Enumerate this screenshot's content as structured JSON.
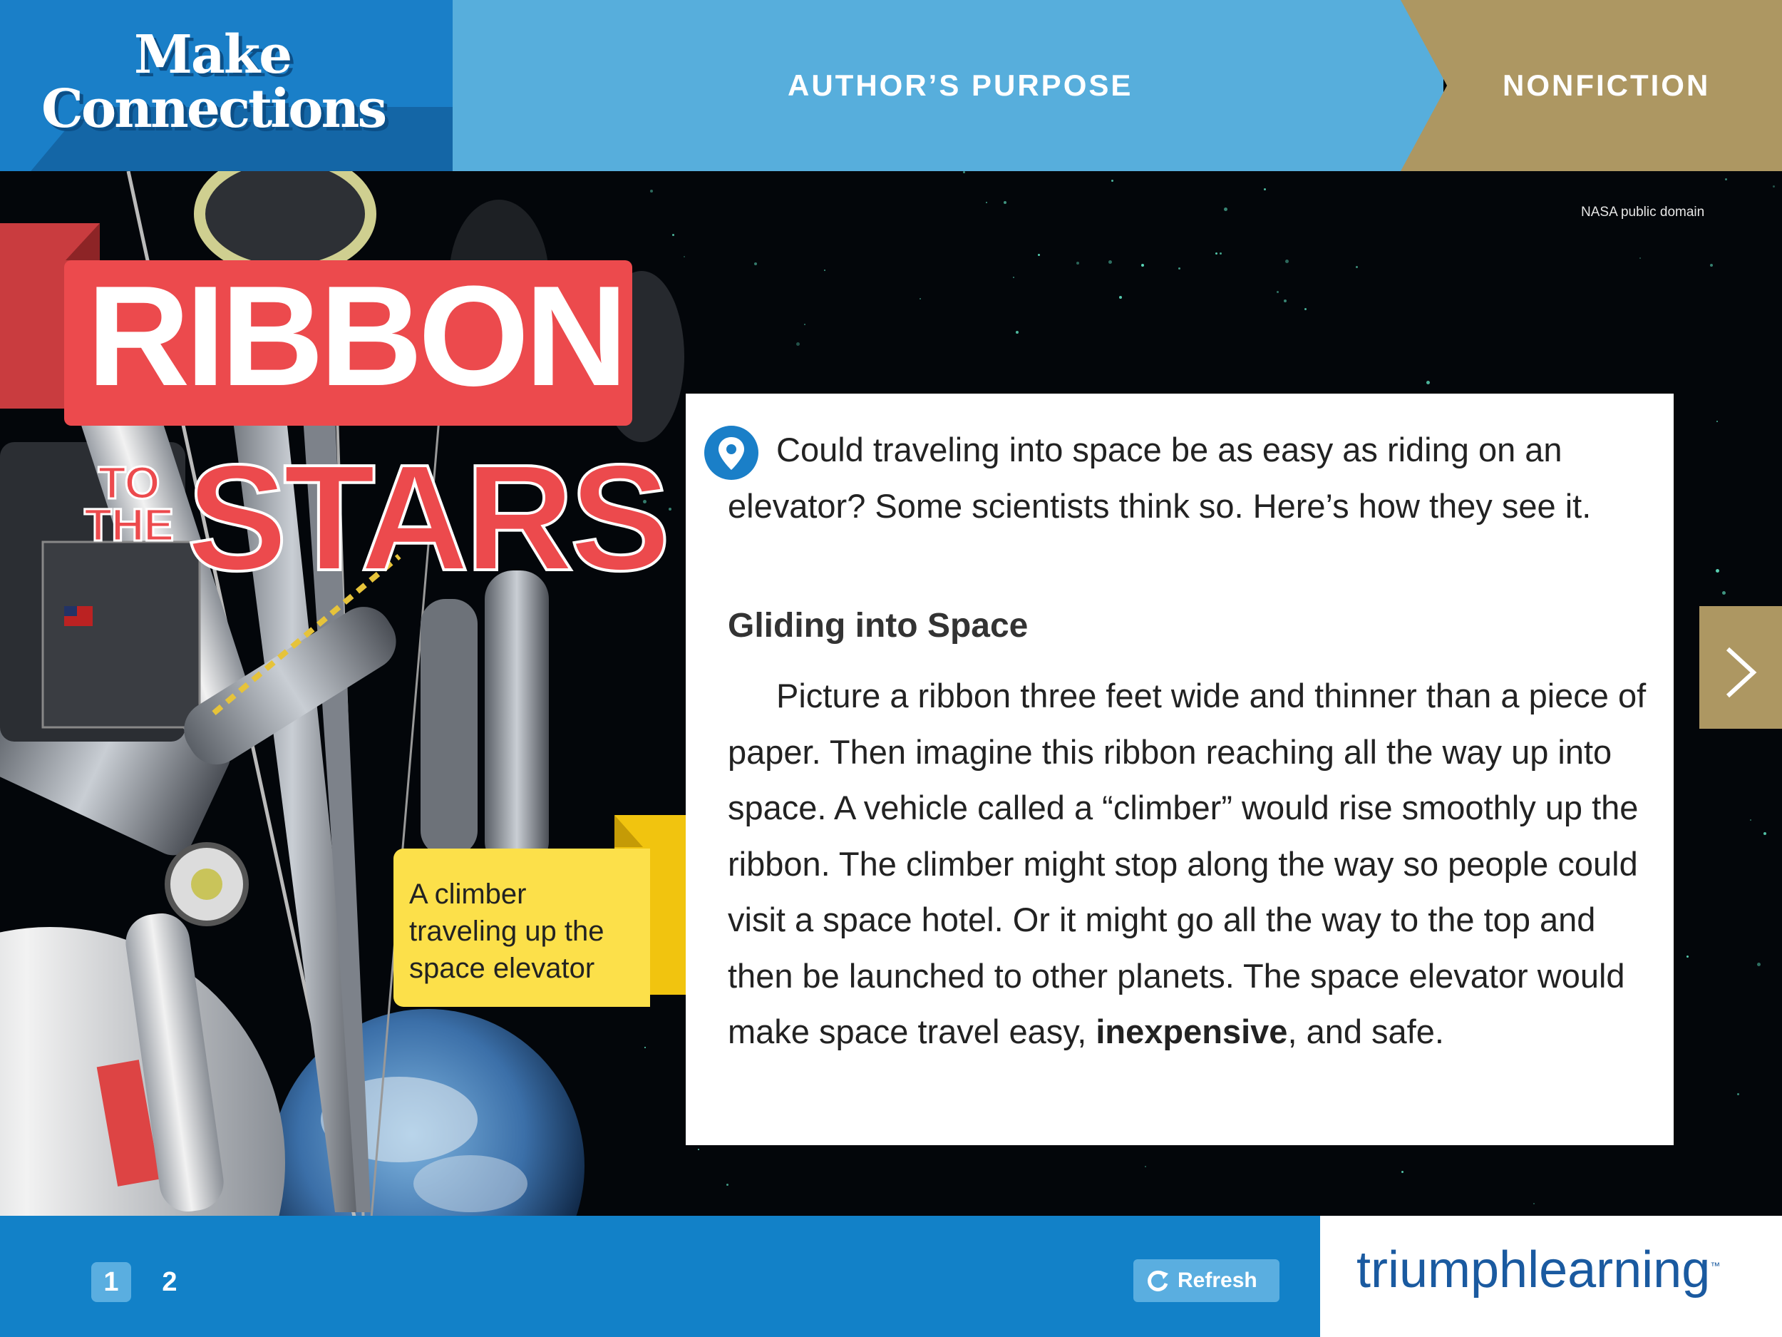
{
  "header": {
    "logo_line1": "Make",
    "logo_line2": "Connections",
    "lesson_label": "AUTHOR’S PURPOSE",
    "genre_label": "NONFICTION"
  },
  "image": {
    "credit": "NASA public domain"
  },
  "title": {
    "line1": "RIBBON",
    "small_to": "TO",
    "small_the": "THE",
    "line2": "STARS"
  },
  "caption": {
    "text": "A climber traveling up the space elevator"
  },
  "article": {
    "intro": "Could traveling into space be as easy as riding on an elevator? Some scientists think so. Here’s how they see it.",
    "subhead": "Gliding into Space",
    "body_before_bold": "Picture a ribbon three feet wide and thinner than a piece of paper. Then imagine this ribbon reaching all the way up into space. A vehicle called a “climber” would rise smoothly up the ribbon. The climber might stop along the way so people could visit a space hotel. Or it might go all the way to the top and then be launched to other planets. The space elevator would make space travel easy, ",
    "body_bold": "inexpensive",
    "body_after_bold": ", and safe."
  },
  "navigation": {
    "next_icon": "chevron-right-icon",
    "pages": [
      "1",
      "2"
    ],
    "current_page": "1"
  },
  "footer": {
    "refresh_label": "Refresh",
    "brand": "triumphlearning",
    "brand_mark": "™"
  },
  "colors": {
    "header_blue": "#1a7fc8",
    "band_light_blue": "#57aedc",
    "genre_gold": "#ad9762",
    "title_red": "#ec4a4d",
    "caption_yellow": "#fce04a",
    "footer_blue": "#1281c8"
  }
}
